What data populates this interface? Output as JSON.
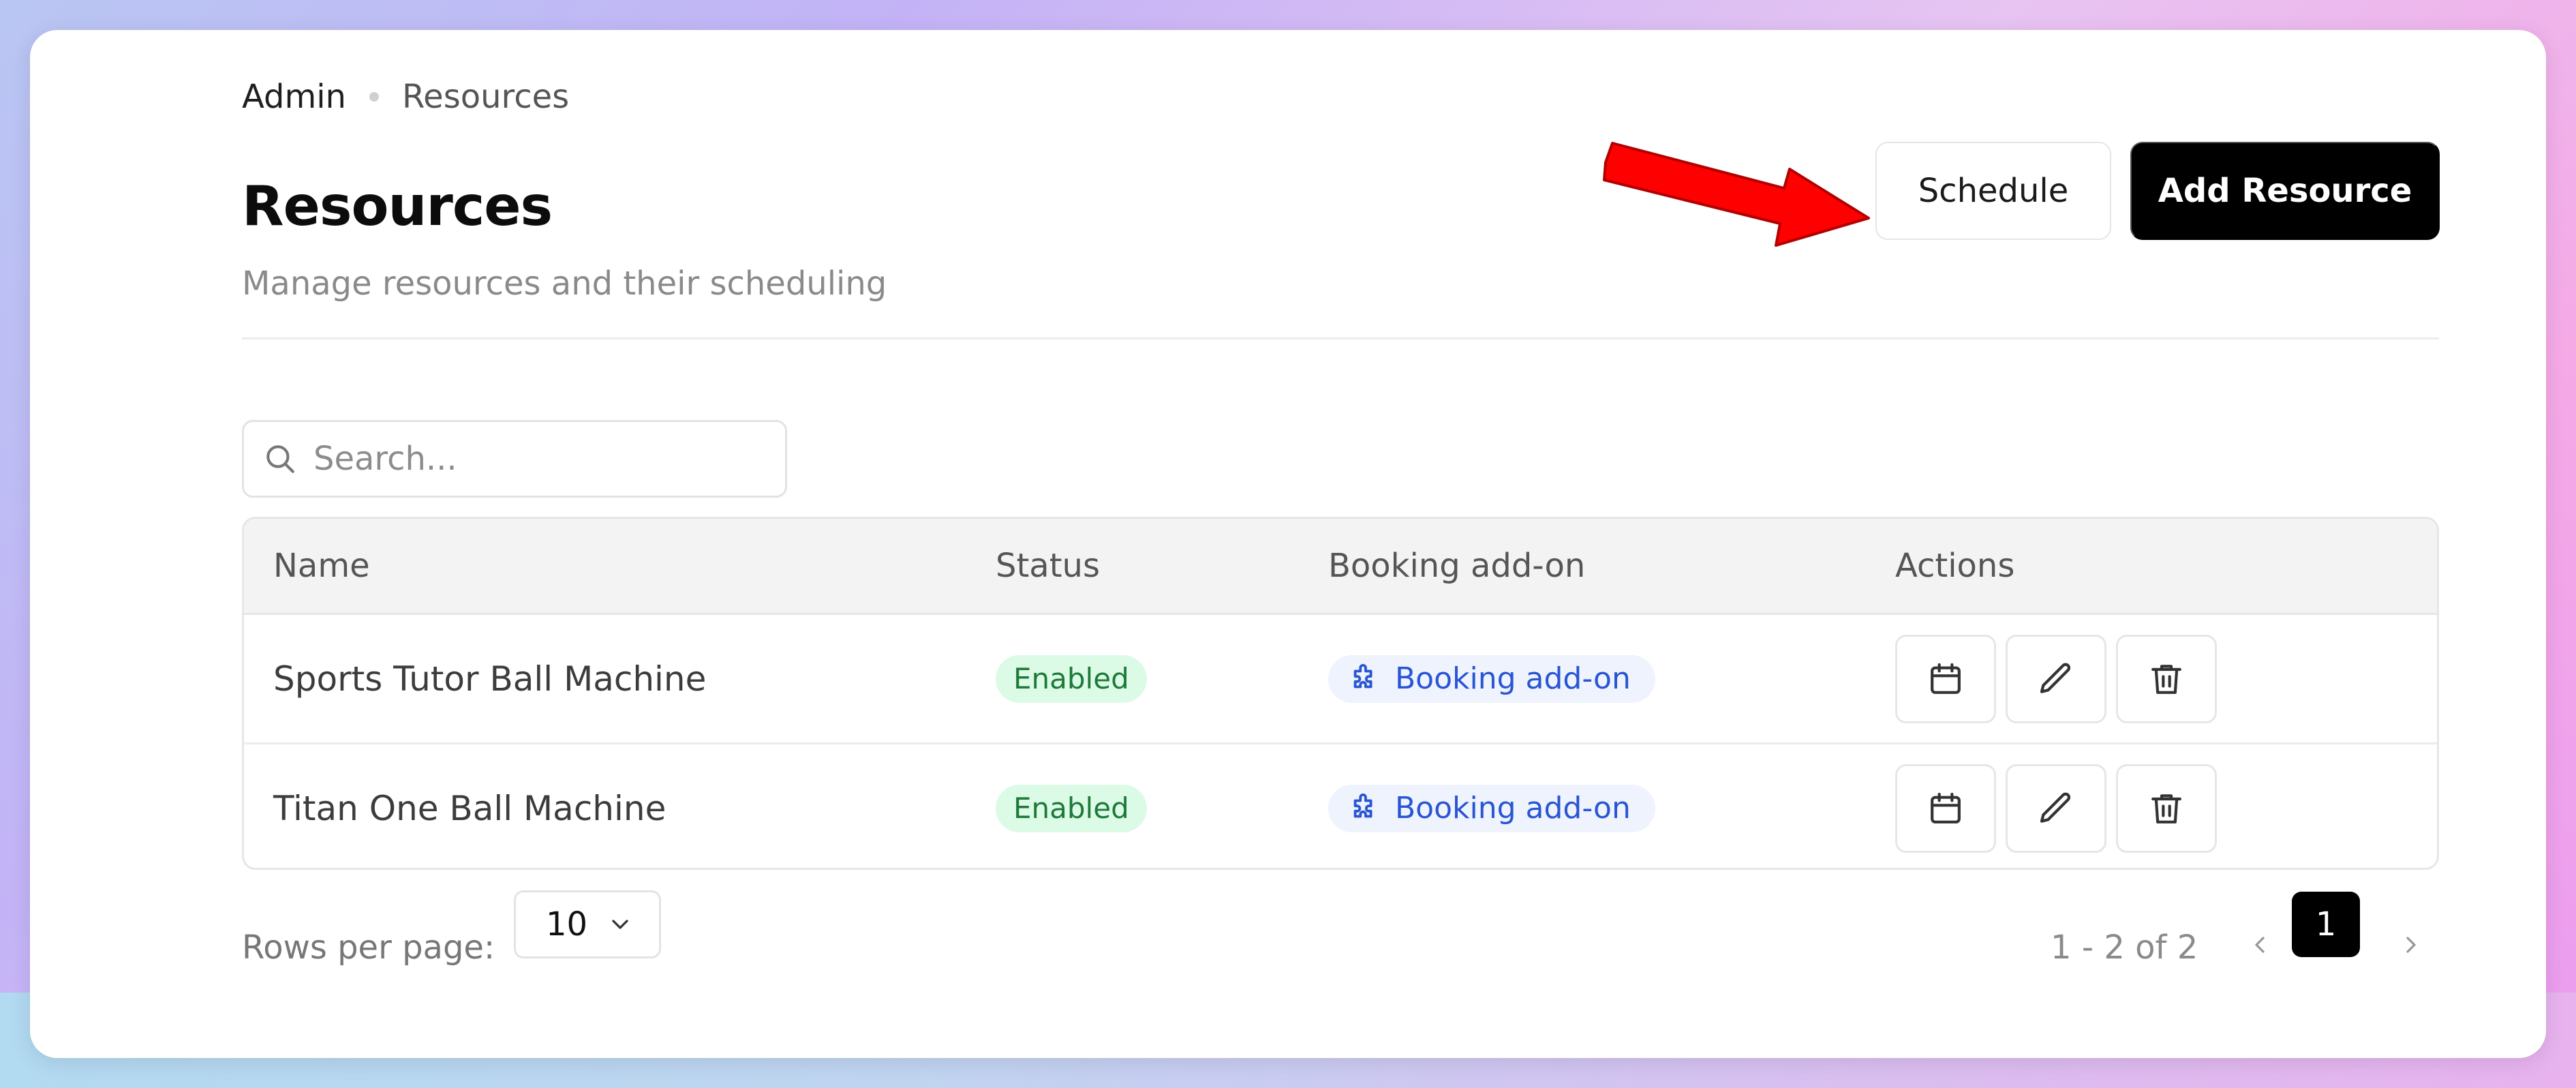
{
  "breadcrumb": {
    "root": "Admin",
    "current": "Resources"
  },
  "header": {
    "title": "Resources",
    "subtitle": "Manage resources and their scheduling",
    "schedule_label": "Schedule",
    "add_label": "Add Resource"
  },
  "search": {
    "placeholder": "Search...",
    "value": ""
  },
  "table": {
    "columns": [
      "Name",
      "Status",
      "Booking add-on",
      "Actions"
    ],
    "rows": [
      {
        "name": "Sports Tutor Ball Machine",
        "status": "Enabled",
        "addon": "Booking add-on"
      },
      {
        "name": "Titan One Ball Machine",
        "status": "Enabled",
        "addon": "Booking add-on"
      }
    ]
  },
  "pagination": {
    "rows_per_page_label": "Rows per page:",
    "rows_per_page_value": "10",
    "range": "1 - 2 of 2",
    "current_page": "1"
  },
  "colors": {
    "primary": "#000000",
    "status_green_bg": "#dcfbe6",
    "status_green_text": "#1d7a3a",
    "addon_blue_bg": "#eef3fe",
    "addon_blue_text": "#2a55d3",
    "annotation_arrow": "#ff0000"
  },
  "icons": {
    "search": "search-icon",
    "addon": "puzzle-icon",
    "actions": [
      "calendar-icon",
      "pencil-icon",
      "trash-icon"
    ],
    "select": "chevron-down-icon",
    "prev": "chevron-left-icon",
    "next": "chevron-right-icon"
  }
}
